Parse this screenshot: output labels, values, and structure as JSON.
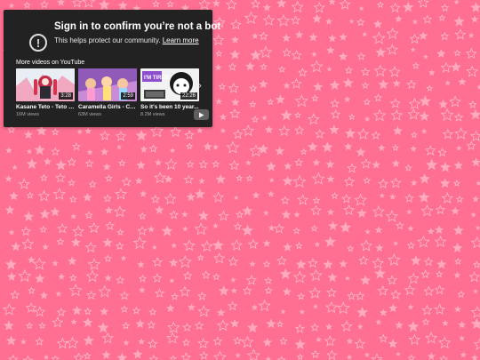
{
  "colors": {
    "background": "#fe6f91",
    "star": "#ffb3c6",
    "panel": "#222222"
  },
  "signin": {
    "title": "Sign in to confirm you’re not a bot",
    "subtitle": "This helps protect our community.",
    "link": "Learn more",
    "icon": "alert-circle-icon"
  },
  "more_videos": {
    "label": "More videos on YouTube",
    "items": [
      {
        "title": "Kasane Teto - Teto t...",
        "views": "16M views",
        "duration": "3:28"
      },
      {
        "title": "Caramella Girls - Ca...",
        "views": "63M views",
        "duration": "2:59"
      },
      {
        "title": "So it's been 10 year...",
        "views": "8.2M views",
        "duration": "22:26",
        "thumb_text": "I'M TIRED"
      }
    ],
    "next_icon": "chevron-right-icon",
    "logo_icon": "youtube-logo-icon"
  }
}
